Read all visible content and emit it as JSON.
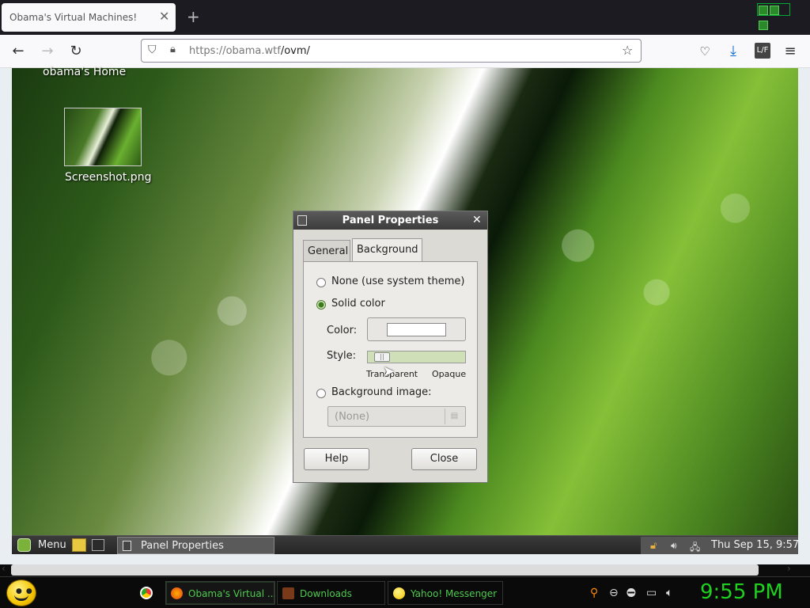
{
  "browser": {
    "tab_title": "Obama's Virtual Machines!",
    "url_host": "https://obama.wtf",
    "url_path": "/ovm/"
  },
  "desktop": {
    "home_label": "obama's Home",
    "file_label": "Screenshot.png"
  },
  "dialog": {
    "title": "Panel Properties",
    "tabs": [
      "General",
      "Background"
    ],
    "active_tab": "Background",
    "options": {
      "none": "None (use system theme)",
      "solid": "Solid color",
      "image": "Background image:"
    },
    "selected_option": "Solid color",
    "color_label": "Color:",
    "style_label": "Style:",
    "slider_min": "Transparent",
    "slider_max": "Opaque",
    "image_select": "(None)",
    "help_button": "Help",
    "close_button": "Close"
  },
  "vnc_panel": {
    "menu_label": "Menu",
    "task_label": "Panel Properties",
    "clock": "Thu Sep 15,  9:57"
  },
  "host_taskbar": {
    "items": [
      "Obama's Virtual ...",
      "Downloads",
      "Yahoo! Messenger"
    ],
    "clock": "9:55 PM"
  },
  "colors": {
    "accent_green": "#4fc94f",
    "clock_green": "#1fd01f",
    "dialog_bg": "#dcdad5"
  }
}
